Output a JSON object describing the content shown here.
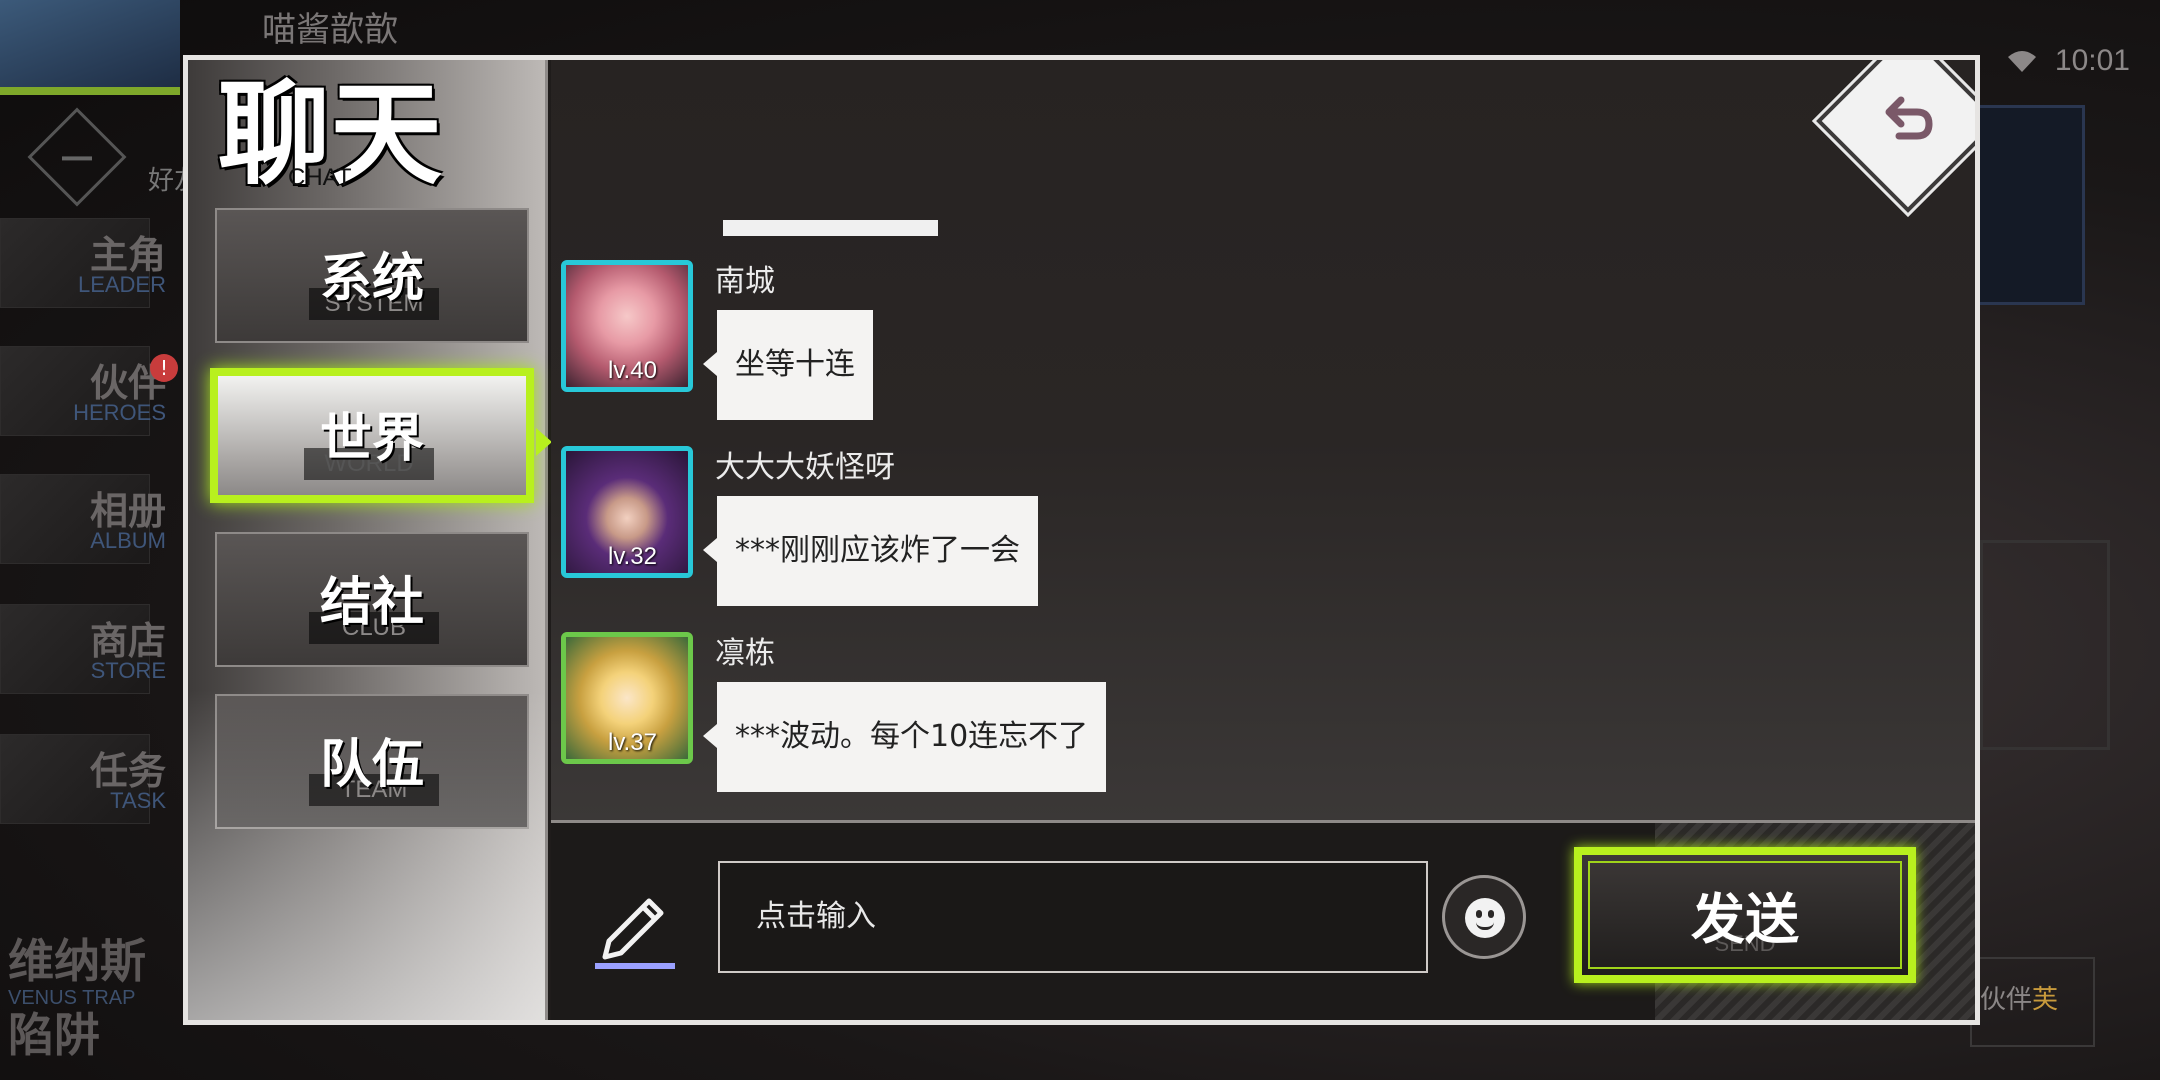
{
  "background": {
    "username": "喵酱歆歆",
    "time": "10:01",
    "friends_label": "好友",
    "nav": [
      {
        "cn": "主角",
        "en": "LEADER"
      },
      {
        "cn": "伙伴",
        "en": "HEROES"
      },
      {
        "cn": "相册",
        "en": "ALBUM"
      },
      {
        "cn": "商店",
        "en": "STORE"
      },
      {
        "cn": "任务",
        "en": "TASK"
      }
    ],
    "heroes_badge": "!",
    "banner_cn_1": "维纳斯",
    "banner_en": "VENUS TRAP",
    "banner_cn_2": "陷阱",
    "partner_label": "伙伴",
    "partner_suffix": "芙"
  },
  "chat": {
    "title": "聊天",
    "title_en": "CHAT",
    "tabs": [
      {
        "label": "系统",
        "sub": "SYSTEM",
        "active": false
      },
      {
        "label": "世界",
        "sub": "WORLD",
        "active": true
      },
      {
        "label": "结社",
        "sub": "CLUB",
        "active": false
      },
      {
        "label": "队伍",
        "sub": "TEAM",
        "active": false
      }
    ],
    "messages": [
      {
        "name": "南城",
        "level": "lv.40",
        "text": "坐等十连"
      },
      {
        "name": "大大大妖怪呀",
        "level": "lv.32",
        "text": "***刚刚应该炸了一会"
      },
      {
        "name": "凛栋",
        "level": "lv.37",
        "text": "***波动。每个10连忘不了"
      }
    ],
    "input_placeholder": "点击输入",
    "send_label": "发送",
    "send_sub": "SEND"
  },
  "colors": {
    "accent": "#b8f01e",
    "avatar_border": "#28c8d8",
    "dialog_border": "#e6e4e2"
  },
  "icons": {
    "back": "undo-arrow-icon",
    "pencil": "pencil-icon",
    "emoji": "smiley-icon"
  }
}
